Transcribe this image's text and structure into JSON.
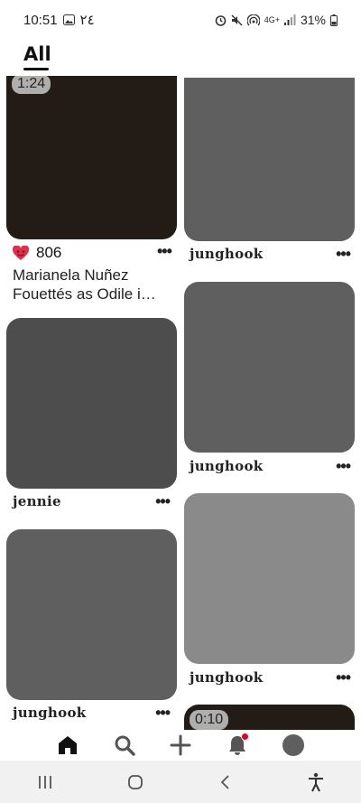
{
  "status_bar": {
    "time": "10:51",
    "date_arabic": "٢٤",
    "battery": "31%",
    "network": "4G+"
  },
  "tabs": {
    "all_label": "All"
  },
  "pins": [
    {
      "duration": "1:24",
      "likes": "806",
      "title": "Marianela Nuñez Fouettés as Odile i…",
      "color": "#231c16"
    },
    {
      "author": "junghook",
      "color": "#5f5f5f"
    },
    {
      "author": "jennie",
      "color": "#4d4d4d"
    },
    {
      "author": "junghook",
      "color": "#5f5f5f"
    },
    {
      "author": "junghook",
      "color": "#5f5f5f"
    },
    {
      "author": "junghook",
      "color": "#8a8a8a"
    },
    {
      "duration": "0:10",
      "color": "#231c16"
    }
  ],
  "more_label": "•••",
  "nav": {
    "home": "home-icon",
    "search": "search-icon",
    "create": "plus-icon",
    "notifications": "bell-icon",
    "profile": "profile-icon"
  },
  "colors": {
    "notification_dot": "#e60023",
    "heart": "#e0304a"
  }
}
